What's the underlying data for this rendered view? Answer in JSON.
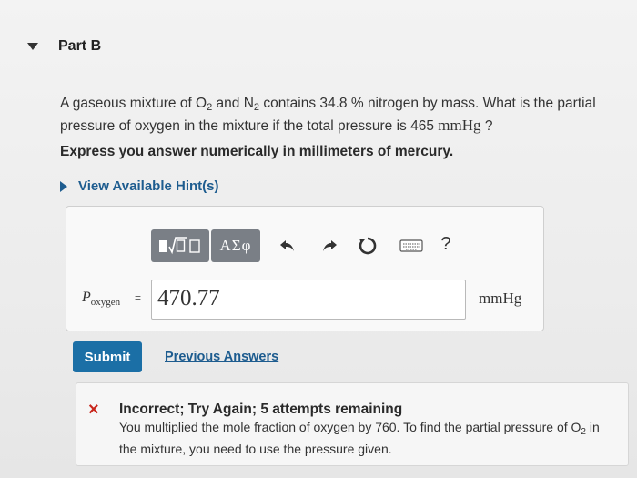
{
  "part": {
    "title": "Part B"
  },
  "question": {
    "text_1": "A gaseous mixture of O",
    "o2_sub": "2",
    "text_2": " and N",
    "n2_sub": "2",
    "text_3": " contains 34.8 % nitrogen by mass. What is the partial pressure of oxygen in the mixture if the total pressure is 465 ",
    "unit": "mmHg",
    "text_4": " ?"
  },
  "instruction": "Express you answer numerically in millimeters of mercury.",
  "hints": {
    "label": "View Available Hint(s)"
  },
  "toolbar": {
    "greek_label": "ΑΣφ",
    "help_label": "?",
    "icons": [
      "template-icon",
      "undo-icon",
      "redo-icon",
      "reset-icon",
      "keyboard-icon",
      "help-icon"
    ]
  },
  "answer": {
    "var_main": "P",
    "var_sub": "oxygen",
    "equals": "=",
    "value": "470.77",
    "unit": "mmHg"
  },
  "actions": {
    "submit_label": "Submit",
    "previous_label": "Previous Answers"
  },
  "feedback": {
    "icon": "×",
    "title": "Incorrect; Try Again; 5 attempts remaining",
    "msg_1": "You multiplied the mole fraction of oxygen by 760. To find the partial pressure of O",
    "msg_sub": "2",
    "msg_2": " in the mixture, you need to use the pressure given.",
    "status_color": "#c8261c"
  },
  "colors": {
    "accent": "#1b6fa6",
    "link": "#1d5c8f",
    "error": "#c8261c"
  }
}
